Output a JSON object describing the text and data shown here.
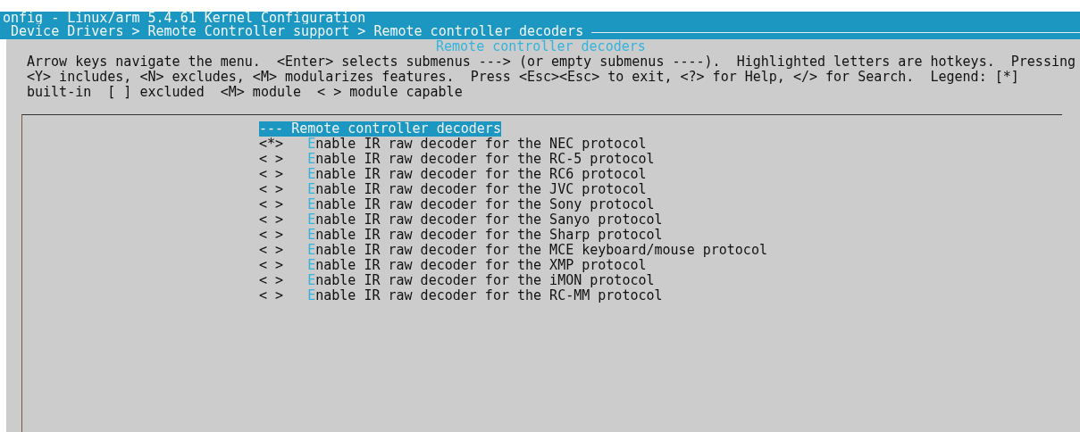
{
  "window": {
    "title": "onfig - Linux/arm 5.4.61 Kernel Configuration",
    "breadcrumb": "Device Drivers > Remote Controller support > Remote controller decoders"
  },
  "dialog": {
    "title": "Remote controller decoders",
    "help": [
      "Arrow keys navigate the menu.  <Enter> selects submenus ---> (or empty submenus ----).  Highlighted letters are hotkeys.  Pressing",
      "<Y> includes, <N> excludes, <M> modularizes features.  Press <Esc><Esc> to exit, <?> for Help, </> for Search.  Legend: [*]",
      "built-in  [ ] excluded  <M> module  < > module capable"
    ]
  },
  "menu": [
    {
      "kind": "heading",
      "prefix": "---",
      "label": "Remote controller decoders",
      "selected": true
    },
    {
      "kind": "option",
      "prefix": "<*>",
      "label": "Enable IR raw decoder for the NEC protocol",
      "selected": false
    },
    {
      "kind": "option",
      "prefix": "< >",
      "label": "Enable IR raw decoder for the RC-5 protocol",
      "selected": false
    },
    {
      "kind": "option",
      "prefix": "< >",
      "label": "Enable IR raw decoder for the RC6 protocol",
      "selected": false
    },
    {
      "kind": "option",
      "prefix": "< >",
      "label": "Enable IR raw decoder for the JVC protocol",
      "selected": false
    },
    {
      "kind": "option",
      "prefix": "< >",
      "label": "Enable IR raw decoder for the Sony protocol",
      "selected": false
    },
    {
      "kind": "option",
      "prefix": "< >",
      "label": "Enable IR raw decoder for the Sanyo protocol",
      "selected": false
    },
    {
      "kind": "option",
      "prefix": "< >",
      "label": "Enable IR raw decoder for the Sharp protocol",
      "selected": false
    },
    {
      "kind": "option",
      "prefix": "< >",
      "label": "Enable IR raw decoder for the MCE keyboard/mouse protocol",
      "selected": false
    },
    {
      "kind": "option",
      "prefix": "< >",
      "label": "Enable IR raw decoder for the XMP protocol",
      "selected": false
    },
    {
      "kind": "option",
      "prefix": "< >",
      "label": "Enable IR raw decoder for the iMON protocol",
      "selected": false
    },
    {
      "kind": "option",
      "prefix": "< >",
      "label": "Enable IR raw decoder for the RC-MM protocol",
      "selected": false
    }
  ]
}
